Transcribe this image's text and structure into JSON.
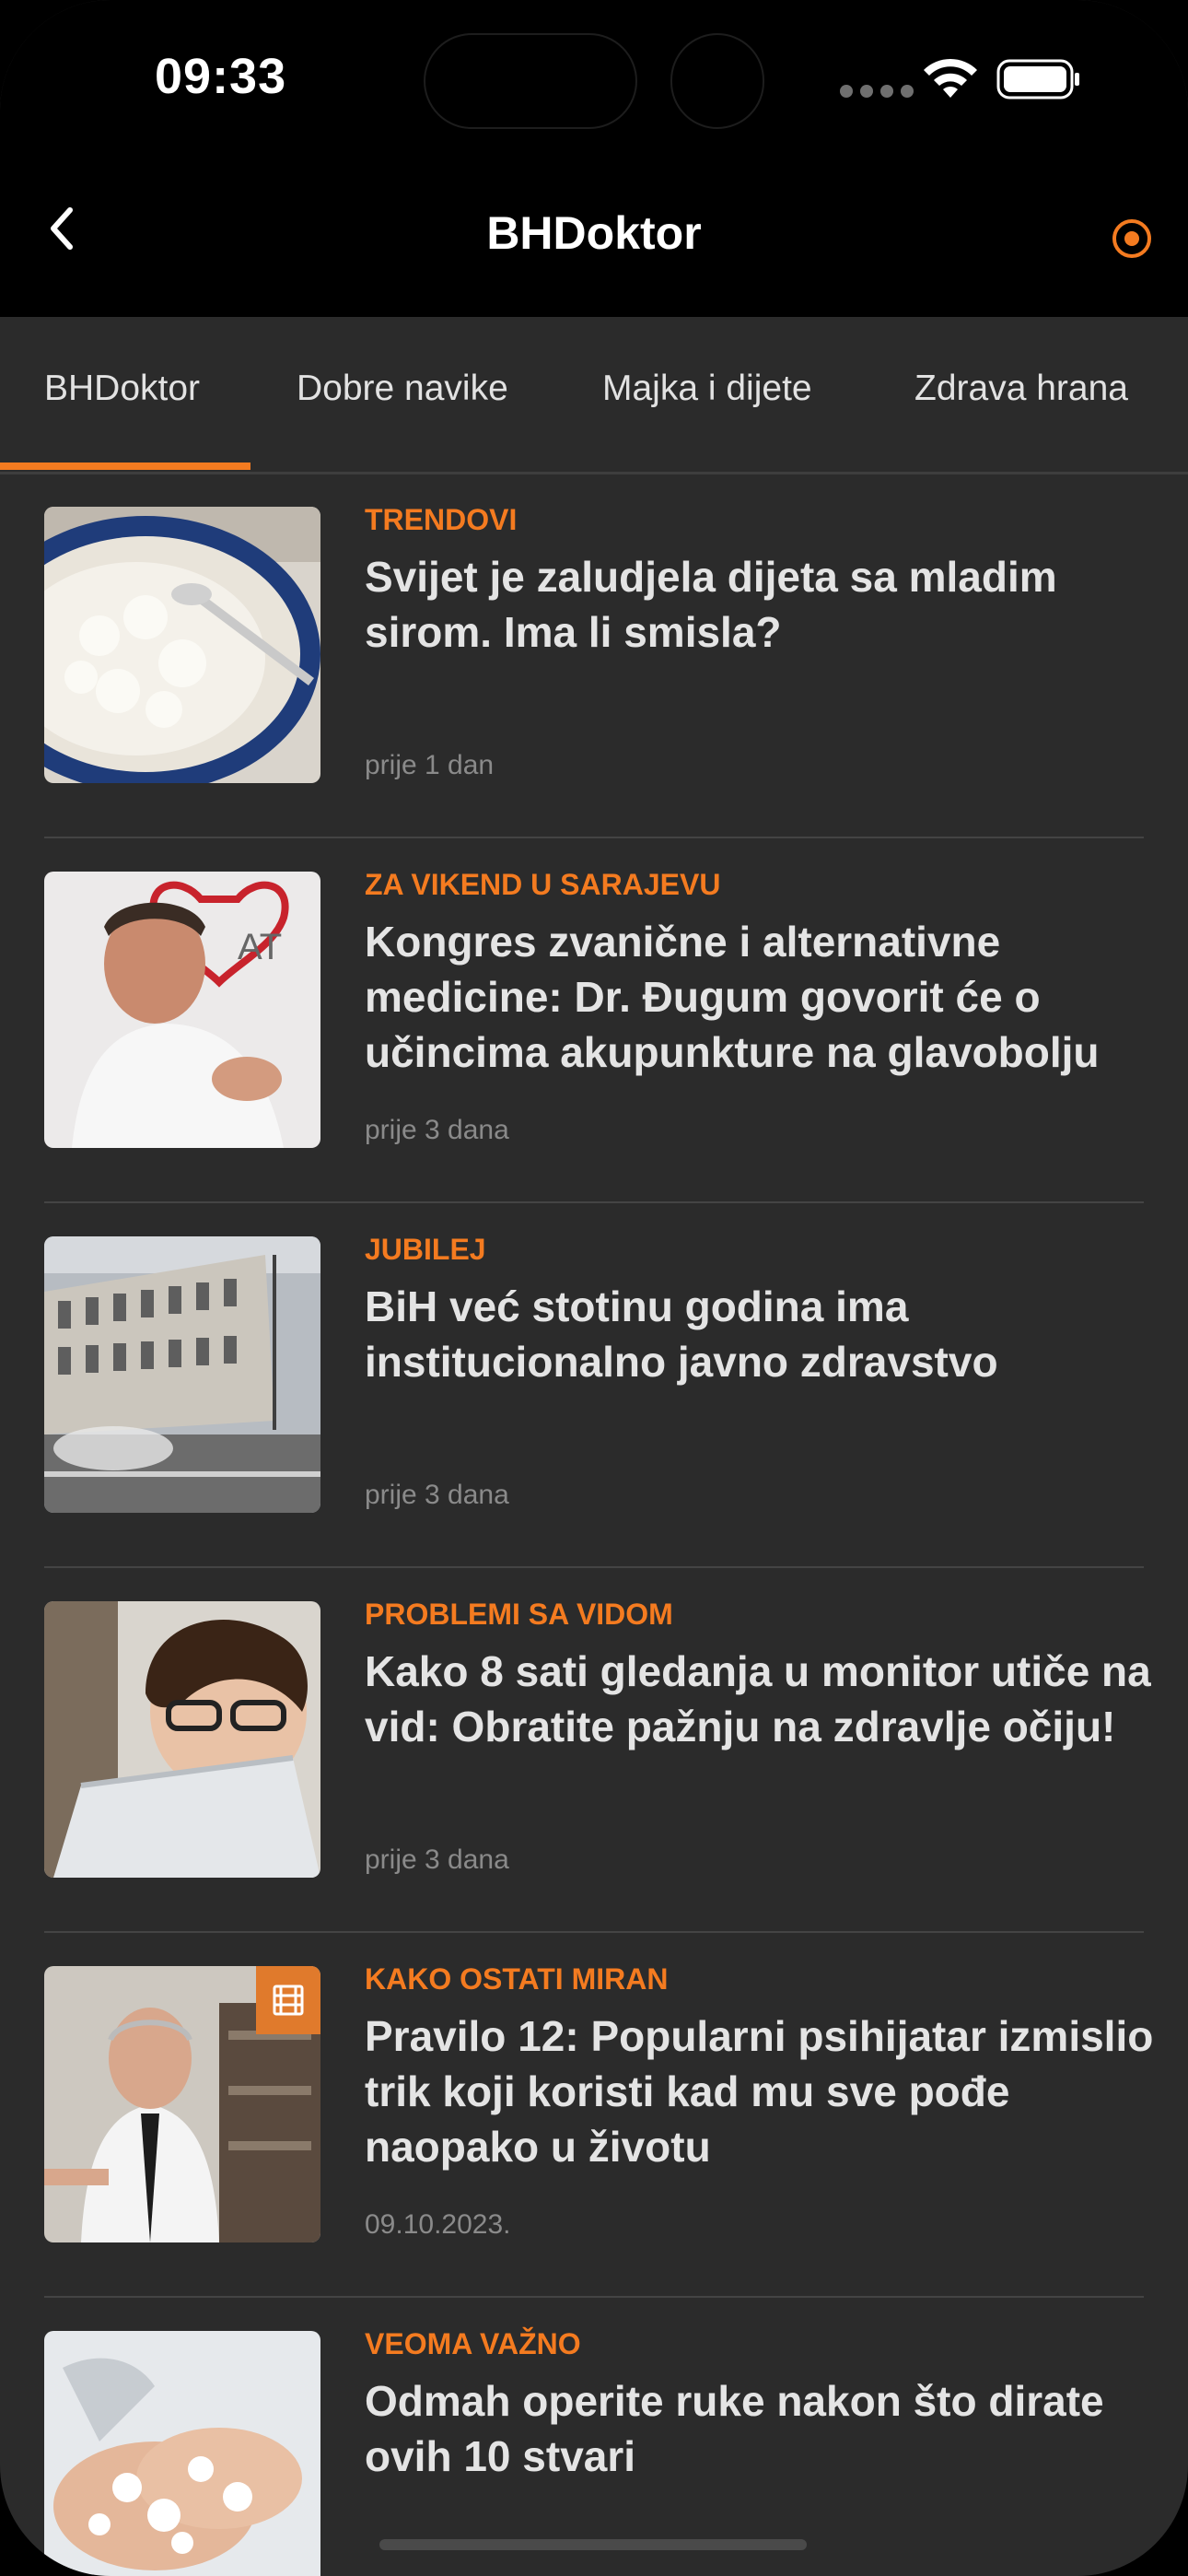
{
  "status": {
    "time": "09:33"
  },
  "nav": {
    "title": "BHDoktor"
  },
  "tabs": [
    {
      "label": "BHDoktor",
      "active": true
    },
    {
      "label": "Dobre navike"
    },
    {
      "label": "Majka i dijete"
    },
    {
      "label": "Zdrava hrana"
    }
  ],
  "colors": {
    "accent": "#f47b20",
    "background": "#2b2b2b",
    "bar": "#000000"
  },
  "articles": [
    {
      "category": "TRENDOVI",
      "title": "Svijet je zaludjela dijeta sa mladim sirom. Ima li smisla?",
      "time": "prije 1 dan",
      "thumb": "cottage-cheese-bowl"
    },
    {
      "category": "ZA VIKEND U SARAJEVU",
      "title": "Kongres zvanične i alternativne medicine: Dr. Đugum govorit će o učincima akupunkture na glavobolju",
      "time": "prije 3 dana",
      "thumb": "doctor-portrait"
    },
    {
      "category": "JUBILEJ",
      "title": "BiH već stotinu godina ima institucionalno javno zdravstvo",
      "time": "prije 3 dana",
      "thumb": "institute-building"
    },
    {
      "category": "PROBLEMI SA VIDOM",
      "title": "Kako 8 sati gledanja u monitor utiče na vid: Obratite pažnju na zdravlje očiju!",
      "time": "prije 3 dana",
      "thumb": "boy-with-laptop"
    },
    {
      "category": "KAKO OSTATI MIRAN",
      "title": "Pravilo 12: Popularni psihijatar izmislio trik koji koristi kad mu sve pođe naopako u životu",
      "time": "09.10.2023.",
      "thumb": "psychiatrist-office",
      "video": true
    },
    {
      "category": "VEOMA VAŽNO",
      "title": "Odmah operite ruke nakon što dirate ovih 10 stvari",
      "time": "",
      "thumb": "washing-hands"
    }
  ]
}
